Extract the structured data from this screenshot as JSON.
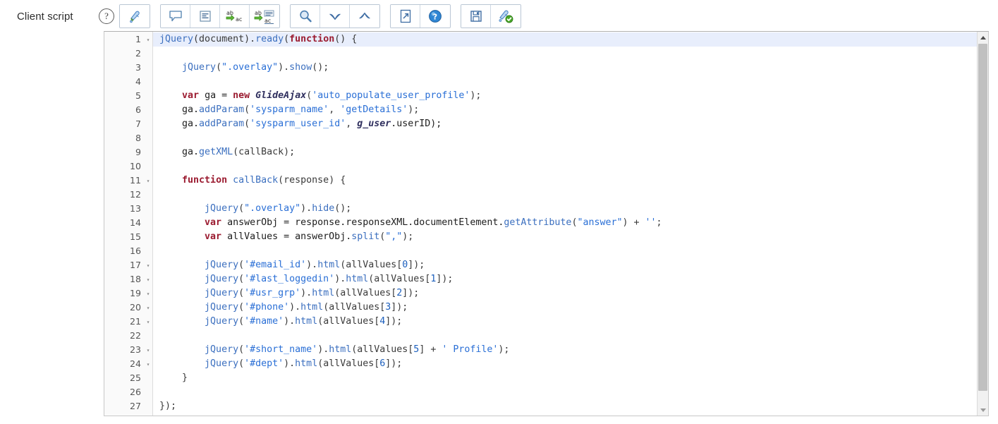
{
  "field": {
    "label": "Client script",
    "help_icon": "help-circle-icon",
    "help_glyph": "?"
  },
  "toolbar": {
    "groups": [
      {
        "name": "format-group",
        "buttons": [
          {
            "name": "format-code-button",
            "icon": "paintbrush-format-icon",
            "title": "Format Code"
          }
        ]
      },
      {
        "name": "edit-group",
        "buttons": [
          {
            "name": "toggle-comment-button",
            "icon": "comment-bubble-icon",
            "title": "Toggle Comment"
          },
          {
            "name": "indent-lines-button",
            "icon": "indent-lines-icon",
            "title": "Indent"
          },
          {
            "name": "replace-button",
            "icon": "replace-ab-ac-icon",
            "title": "Replace"
          },
          {
            "name": "replace-all-button",
            "icon": "replace-all-ab-ac-icon",
            "title": "Replace All"
          }
        ]
      },
      {
        "name": "search-group",
        "buttons": [
          {
            "name": "find-button",
            "icon": "magnifier-icon",
            "title": "Find"
          },
          {
            "name": "find-next-button",
            "icon": "chevron-down-icon",
            "title": "Find Next"
          },
          {
            "name": "find-previous-button",
            "icon": "chevron-up-icon",
            "title": "Find Previous"
          }
        ]
      },
      {
        "name": "window-group",
        "buttons": [
          {
            "name": "open-fullscreen-button",
            "icon": "external-arrow-icon",
            "title": "Full Screen"
          },
          {
            "name": "syntax-help-button",
            "icon": "question-circle-blue-icon",
            "title": "Syntax Editor Help"
          }
        ]
      },
      {
        "name": "save-group",
        "buttons": [
          {
            "name": "save-button",
            "icon": "floppy-disk-icon",
            "title": "Save"
          },
          {
            "name": "validate-script-button",
            "icon": "brush-check-icon",
            "title": "Check Syntax"
          }
        ]
      }
    ]
  },
  "editor": {
    "active_line": 1,
    "total_lines": 27,
    "colors": {
      "active_line_bg": "#e8eefc",
      "gutter_bg": "#fafafa",
      "keyword": "#9b1b30",
      "string": "#2a6fd6",
      "identifier": "#3b6fbf",
      "class": "#2f2f5e",
      "number": "#1c5fbd"
    },
    "fold_marker": "▾",
    "lines": [
      {
        "n": "1",
        "fold": true,
        "tokens": [
          {
            "t": "jQuery",
            "c": "ident"
          },
          {
            "t": "(document).",
            "c": "punct"
          },
          {
            "t": "ready",
            "c": "ident"
          },
          {
            "t": "(",
            "c": "punct"
          },
          {
            "t": "function",
            "c": "kw"
          },
          {
            "t": "() {",
            "c": "punct"
          }
        ]
      },
      {
        "n": "2",
        "fold": false,
        "tokens": []
      },
      {
        "n": "3",
        "fold": false,
        "tokens": [
          {
            "t": "    ",
            "c": "plain"
          },
          {
            "t": "jQuery",
            "c": "ident"
          },
          {
            "t": "(",
            "c": "punct"
          },
          {
            "t": "\".overlay\"",
            "c": "str"
          },
          {
            "t": ").",
            "c": "punct"
          },
          {
            "t": "show",
            "c": "ident"
          },
          {
            "t": "();",
            "c": "punct"
          }
        ]
      },
      {
        "n": "4",
        "fold": false,
        "tokens": []
      },
      {
        "n": "5",
        "fold": false,
        "tokens": [
          {
            "t": "    ",
            "c": "plain"
          },
          {
            "t": "var",
            "c": "kw"
          },
          {
            "t": " ga = ",
            "c": "plain"
          },
          {
            "t": "new",
            "c": "kw"
          },
          {
            "t": " ",
            "c": "plain"
          },
          {
            "t": "GlideAjax",
            "c": "cls"
          },
          {
            "t": "(",
            "c": "punct"
          },
          {
            "t": "'auto_populate_user_profile'",
            "c": "str cls-str"
          },
          {
            "t": ");",
            "c": "punct"
          }
        ]
      },
      {
        "n": "6",
        "fold": false,
        "tokens": [
          {
            "t": "    ga.",
            "c": "plain"
          },
          {
            "t": "addParam",
            "c": "ident"
          },
          {
            "t": "(",
            "c": "punct"
          },
          {
            "t": "'sysparm_name'",
            "c": "str"
          },
          {
            "t": ", ",
            "c": "punct"
          },
          {
            "t": "'getDetails'",
            "c": "str"
          },
          {
            "t": ");",
            "c": "punct"
          }
        ]
      },
      {
        "n": "7",
        "fold": false,
        "tokens": [
          {
            "t": "    ga.",
            "c": "plain"
          },
          {
            "t": "addParam",
            "c": "ident"
          },
          {
            "t": "(",
            "c": "punct"
          },
          {
            "t": "'sysparm_user_id'",
            "c": "str"
          },
          {
            "t": ", ",
            "c": "punct"
          },
          {
            "t": "g_user",
            "c": "cls"
          },
          {
            "t": ".userID);",
            "c": "plain"
          }
        ]
      },
      {
        "n": "8",
        "fold": false,
        "tokens": []
      },
      {
        "n": "9",
        "fold": false,
        "tokens": [
          {
            "t": "    ga.",
            "c": "plain"
          },
          {
            "t": "getXML",
            "c": "ident"
          },
          {
            "t": "(callBack);",
            "c": "punct"
          }
        ]
      },
      {
        "n": "10",
        "fold": false,
        "tokens": []
      },
      {
        "n": "11",
        "fold": true,
        "tokens": [
          {
            "t": "    ",
            "c": "plain"
          },
          {
            "t": "function",
            "c": "kw"
          },
          {
            "t": " ",
            "c": "plain"
          },
          {
            "t": "callBack",
            "c": "ident"
          },
          {
            "t": "(response) {",
            "c": "punct"
          }
        ]
      },
      {
        "n": "12",
        "fold": false,
        "tokens": []
      },
      {
        "n": "13",
        "fold": false,
        "tokens": [
          {
            "t": "        ",
            "c": "plain"
          },
          {
            "t": "jQuery",
            "c": "ident"
          },
          {
            "t": "(",
            "c": "punct"
          },
          {
            "t": "\".overlay\"",
            "c": "str"
          },
          {
            "t": ").",
            "c": "punct"
          },
          {
            "t": "hide",
            "c": "ident"
          },
          {
            "t": "();",
            "c": "punct"
          }
        ]
      },
      {
        "n": "14",
        "fold": false,
        "tokens": [
          {
            "t": "        ",
            "c": "plain"
          },
          {
            "t": "var",
            "c": "kw"
          },
          {
            "t": " answerObj = response.responseXML.documentElement.",
            "c": "plain"
          },
          {
            "t": "getAttribute",
            "c": "ident"
          },
          {
            "t": "(",
            "c": "punct"
          },
          {
            "t": "\"answer\"",
            "c": "str"
          },
          {
            "t": ") + ",
            "c": "punct"
          },
          {
            "t": "''",
            "c": "str"
          },
          {
            "t": ";",
            "c": "punct"
          }
        ]
      },
      {
        "n": "15",
        "fold": false,
        "tokens": [
          {
            "t": "        ",
            "c": "plain"
          },
          {
            "t": "var",
            "c": "kw"
          },
          {
            "t": " allValues = answerObj.",
            "c": "plain"
          },
          {
            "t": "split",
            "c": "ident"
          },
          {
            "t": "(",
            "c": "punct"
          },
          {
            "t": "\",\"",
            "c": "str"
          },
          {
            "t": ");",
            "c": "punct"
          }
        ]
      },
      {
        "n": "16",
        "fold": false,
        "tokens": []
      },
      {
        "n": "17",
        "fold": true,
        "tokens": [
          {
            "t": "        ",
            "c": "plain"
          },
          {
            "t": "jQuery",
            "c": "ident"
          },
          {
            "t": "(",
            "c": "punct"
          },
          {
            "t": "'#email_id'",
            "c": "str"
          },
          {
            "t": ").",
            "c": "punct"
          },
          {
            "t": "html",
            "c": "ident"
          },
          {
            "t": "(allValues[",
            "c": "punct"
          },
          {
            "t": "0",
            "c": "num"
          },
          {
            "t": "]);",
            "c": "punct"
          }
        ]
      },
      {
        "n": "18",
        "fold": true,
        "tokens": [
          {
            "t": "        ",
            "c": "plain"
          },
          {
            "t": "jQuery",
            "c": "ident"
          },
          {
            "t": "(",
            "c": "punct"
          },
          {
            "t": "'#last_loggedin'",
            "c": "str"
          },
          {
            "t": ").",
            "c": "punct"
          },
          {
            "t": "html",
            "c": "ident"
          },
          {
            "t": "(allValues[",
            "c": "punct"
          },
          {
            "t": "1",
            "c": "num"
          },
          {
            "t": "]);",
            "c": "punct"
          }
        ]
      },
      {
        "n": "19",
        "fold": true,
        "tokens": [
          {
            "t": "        ",
            "c": "plain"
          },
          {
            "t": "jQuery",
            "c": "ident"
          },
          {
            "t": "(",
            "c": "punct"
          },
          {
            "t": "'#usr_grp'",
            "c": "str"
          },
          {
            "t": ").",
            "c": "punct"
          },
          {
            "t": "html",
            "c": "ident"
          },
          {
            "t": "(allValues[",
            "c": "punct"
          },
          {
            "t": "2",
            "c": "num"
          },
          {
            "t": "]);",
            "c": "punct"
          }
        ]
      },
      {
        "n": "20",
        "fold": true,
        "tokens": [
          {
            "t": "        ",
            "c": "plain"
          },
          {
            "t": "jQuery",
            "c": "ident"
          },
          {
            "t": "(",
            "c": "punct"
          },
          {
            "t": "'#phone'",
            "c": "str"
          },
          {
            "t": ").",
            "c": "punct"
          },
          {
            "t": "html",
            "c": "ident"
          },
          {
            "t": "(allValues[",
            "c": "punct"
          },
          {
            "t": "3",
            "c": "num"
          },
          {
            "t": "]);",
            "c": "punct"
          }
        ]
      },
      {
        "n": "21",
        "fold": true,
        "tokens": [
          {
            "t": "        ",
            "c": "plain"
          },
          {
            "t": "jQuery",
            "c": "ident"
          },
          {
            "t": "(",
            "c": "punct"
          },
          {
            "t": "'#name'",
            "c": "str"
          },
          {
            "t": ").",
            "c": "punct"
          },
          {
            "t": "html",
            "c": "ident"
          },
          {
            "t": "(allValues[",
            "c": "punct"
          },
          {
            "t": "4",
            "c": "num"
          },
          {
            "t": "]);",
            "c": "punct"
          }
        ]
      },
      {
        "n": "22",
        "fold": false,
        "tokens": []
      },
      {
        "n": "23",
        "fold": true,
        "tokens": [
          {
            "t": "        ",
            "c": "plain"
          },
          {
            "t": "jQuery",
            "c": "ident"
          },
          {
            "t": "(",
            "c": "punct"
          },
          {
            "t": "'#short_name'",
            "c": "str"
          },
          {
            "t": ").",
            "c": "punct"
          },
          {
            "t": "html",
            "c": "ident"
          },
          {
            "t": "(allValues[",
            "c": "punct"
          },
          {
            "t": "5",
            "c": "num"
          },
          {
            "t": "] + ",
            "c": "punct"
          },
          {
            "t": "' Profile'",
            "c": "str"
          },
          {
            "t": ");",
            "c": "punct"
          }
        ]
      },
      {
        "n": "24",
        "fold": true,
        "tokens": [
          {
            "t": "        ",
            "c": "plain"
          },
          {
            "t": "jQuery",
            "c": "ident"
          },
          {
            "t": "(",
            "c": "punct"
          },
          {
            "t": "'#dept'",
            "c": "str"
          },
          {
            "t": ").",
            "c": "punct"
          },
          {
            "t": "html",
            "c": "ident"
          },
          {
            "t": "(allValues[",
            "c": "punct"
          },
          {
            "t": "6",
            "c": "num"
          },
          {
            "t": "]);",
            "c": "punct"
          }
        ]
      },
      {
        "n": "25",
        "fold": false,
        "tokens": [
          {
            "t": "    }",
            "c": "punct"
          }
        ]
      },
      {
        "n": "26",
        "fold": false,
        "tokens": []
      },
      {
        "n": "27",
        "fold": false,
        "tokens": [
          {
            "t": "});",
            "c": "punct"
          }
        ]
      }
    ]
  },
  "scrollbar": {
    "name": "vertical-scrollbar",
    "up_arrow": "scroll-up-arrow-icon",
    "down_arrow": "scroll-down-arrow-icon",
    "thumb": "scrollbar-thumb"
  }
}
